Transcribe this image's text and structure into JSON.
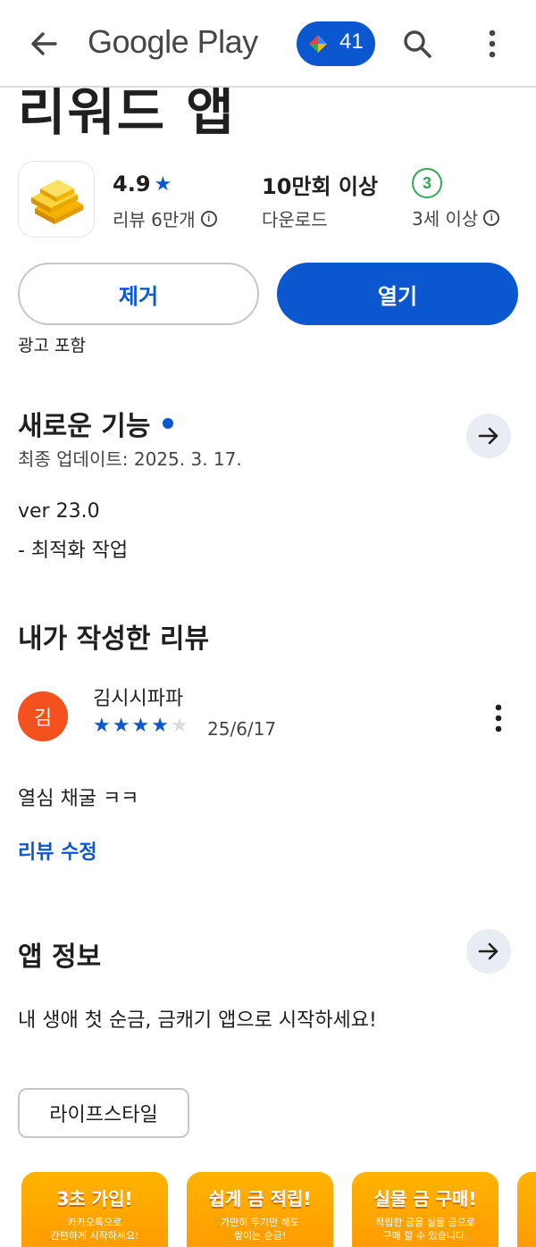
{
  "topbar": {
    "title": "Google Play",
    "points": "41"
  },
  "app": {
    "title": "리워드 앱",
    "rating": "4.9",
    "reviews_label": "리뷰 6만개",
    "downloads": "10만회 이상",
    "downloads_label": "다운로드",
    "age_rating": "3",
    "age_label": "3세 이상",
    "remove_label": "제거",
    "open_label": "열기",
    "ads_note": "광고 포함"
  },
  "whats_new": {
    "title": "새로운 기능",
    "updated": "최종 업데이트: 2025. 3. 17.",
    "version": "ver 23.0",
    "notes": "- 최적화 작업"
  },
  "my_review": {
    "title": "내가 작성한 리뷰",
    "avatar_letter": "김",
    "author": "김시시파파",
    "stars": 4,
    "max_stars": 5,
    "date": "25/6/17",
    "text": "열심 채굴 ㅋㅋ",
    "edit_label": "리뷰 수정"
  },
  "about": {
    "title": "앱 정보",
    "description": "내 생애 첫 순금, 금캐기 앱으로 시작하세요!",
    "category": "라이프스타일"
  },
  "screenshots": [
    {
      "title": "3초 가입!",
      "subtitle": "카카오톡으로\n간편하게 시작하세요!"
    },
    {
      "title": "쉽게 금 적립!",
      "subtitle": "가만히 두기만 해도\n쌓이는 순금!"
    },
    {
      "title": "실물 금 구매!",
      "subtitle": "적립한 금을 실물 금으로\n구매 할 수 있습니다."
    }
  ],
  "colors": {
    "accent": "#0b57d0",
    "age_green": "#34a853",
    "avatar": "#f4511e",
    "card_orange": "#ffa000"
  }
}
